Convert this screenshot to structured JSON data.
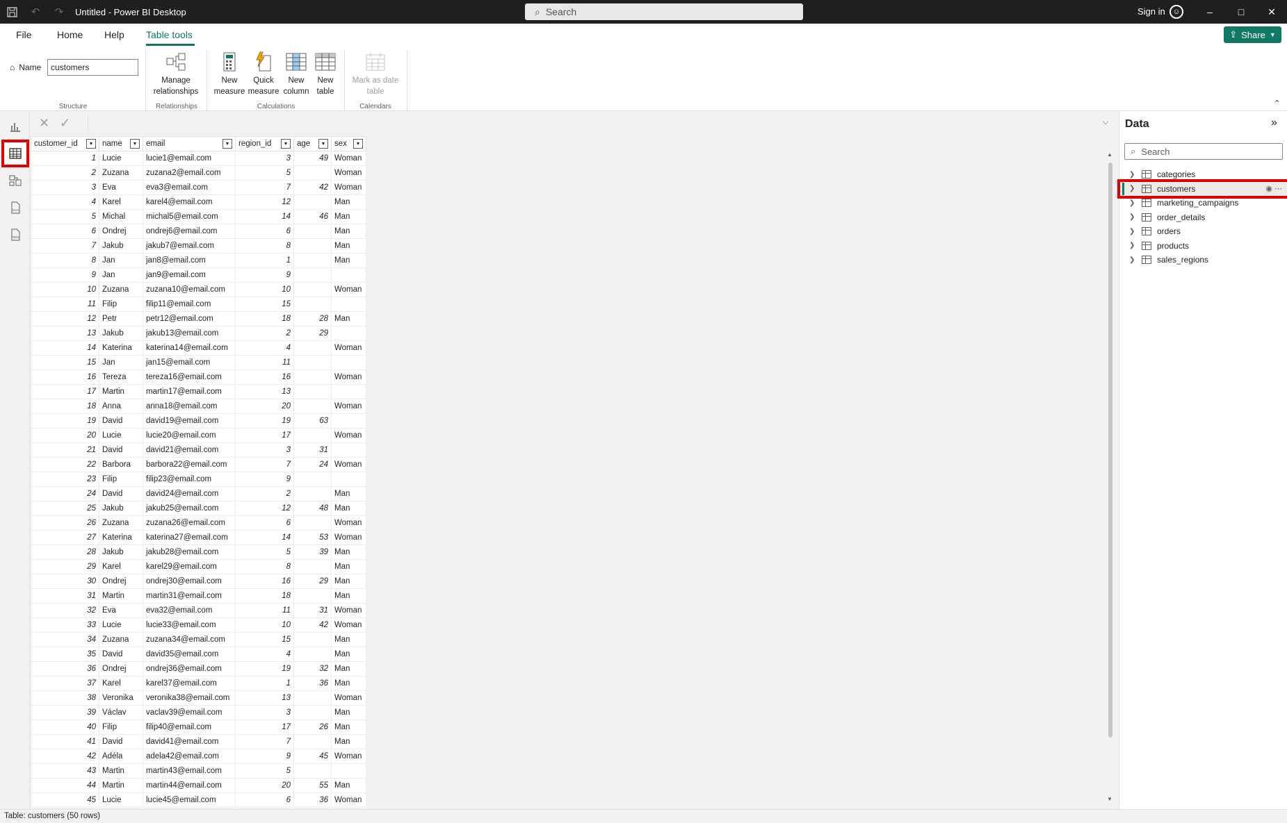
{
  "window": {
    "title": "Untitled - Power BI Desktop",
    "search_placeholder": "Search",
    "sign_in": "Sign in"
  },
  "menu": {
    "tabs": [
      "File",
      "Home",
      "Help",
      "Table tools"
    ],
    "active_tab": "Table tools",
    "share": "Share"
  },
  "ribbon": {
    "name_label": "Name",
    "name_value": "customers",
    "groups": {
      "structure": "Structure",
      "relationships": "Relationships",
      "calculations": "Calculations",
      "calendars": "Calendars"
    },
    "buttons": {
      "manage_relationships": [
        "Manage",
        "relationships"
      ],
      "new_measure": [
        "New",
        "measure"
      ],
      "quick_measure": [
        "Quick",
        "measure"
      ],
      "new_column": [
        "New",
        "column"
      ],
      "new_table": [
        "New",
        "table"
      ],
      "mark_as_date_table": [
        "Mark as date",
        "table"
      ]
    }
  },
  "left_nav": [
    "report-view",
    "table-view",
    "model-view",
    "dax-query-view",
    "tmdl-view"
  ],
  "table": {
    "columns": [
      "customer_id",
      "name",
      "email",
      "region_id",
      "age",
      "sex"
    ],
    "rows": [
      [
        "1",
        "Lucie",
        "lucie1@email.com",
        "3",
        "49",
        "Woman"
      ],
      [
        "2",
        "Zuzana",
        "zuzana2@email.com",
        "5",
        "",
        "Woman"
      ],
      [
        "3",
        "Eva",
        "eva3@email.com",
        "7",
        "42",
        "Woman"
      ],
      [
        "4",
        "Karel",
        "karel4@email.com",
        "12",
        "",
        "Man"
      ],
      [
        "5",
        "Michal",
        "michal5@email.com",
        "14",
        "46",
        "Man"
      ],
      [
        "6",
        "Ondrej",
        "ondrej6@email.com",
        "6",
        "",
        "Man"
      ],
      [
        "7",
        "Jakub",
        "jakub7@email.com",
        "8",
        "",
        "Man"
      ],
      [
        "8",
        "Jan",
        "jan8@email.com",
        "1",
        "",
        "Man"
      ],
      [
        "9",
        "Jan",
        "jan9@email.com",
        "9",
        "",
        ""
      ],
      [
        "10",
        "Zuzana",
        "zuzana10@email.com",
        "10",
        "",
        "Woman"
      ],
      [
        "11",
        "Filip",
        "filip11@email.com",
        "15",
        "",
        ""
      ],
      [
        "12",
        "Petr",
        "petr12@email.com",
        "18",
        "28",
        "Man"
      ],
      [
        "13",
        "Jakub",
        "jakub13@email.com",
        "2",
        "29",
        ""
      ],
      [
        "14",
        "Katerina",
        "katerina14@email.com",
        "4",
        "",
        "Woman"
      ],
      [
        "15",
        "Jan",
        "jan15@email.com",
        "11",
        "",
        ""
      ],
      [
        "16",
        "Tereza",
        "tereza16@email.com",
        "16",
        "",
        "Woman"
      ],
      [
        "17",
        "Martin",
        "martin17@email.com",
        "13",
        "",
        ""
      ],
      [
        "18",
        "Anna",
        "anna18@email.com",
        "20",
        "",
        "Woman"
      ],
      [
        "19",
        "David",
        "david19@email.com",
        "19",
        "63",
        ""
      ],
      [
        "20",
        "Lucie",
        "lucie20@email.com",
        "17",
        "",
        "Woman"
      ],
      [
        "21",
        "David",
        "david21@email.com",
        "3",
        "31",
        ""
      ],
      [
        "22",
        "Barbora",
        "barbora22@email.com",
        "7",
        "24",
        "Woman"
      ],
      [
        "23",
        "Filip",
        "filip23@email.com",
        "9",
        "",
        ""
      ],
      [
        "24",
        "David",
        "david24@email.com",
        "2",
        "",
        "Man"
      ],
      [
        "25",
        "Jakub",
        "jakub25@email.com",
        "12",
        "48",
        "Man"
      ],
      [
        "26",
        "Zuzana",
        "zuzana26@email.com",
        "6",
        "",
        "Woman"
      ],
      [
        "27",
        "Katerina",
        "katerina27@email.com",
        "14",
        "53",
        "Woman"
      ],
      [
        "28",
        "Jakub",
        "jakub28@email.com",
        "5",
        "39",
        "Man"
      ],
      [
        "29",
        "Karel",
        "karel29@email.com",
        "8",
        "",
        "Man"
      ],
      [
        "30",
        "Ondrej",
        "ondrej30@email.com",
        "16",
        "29",
        "Man"
      ],
      [
        "31",
        "Martin",
        "martin31@email.com",
        "18",
        "",
        "Man"
      ],
      [
        "32",
        "Eva",
        "eva32@email.com",
        "11",
        "31",
        "Woman"
      ],
      [
        "33",
        "Lucie",
        "lucie33@email.com",
        "10",
        "42",
        "Woman"
      ],
      [
        "34",
        "Zuzana",
        "zuzana34@email.com",
        "15",
        "",
        "Man"
      ],
      [
        "35",
        "David",
        "david35@email.com",
        "4",
        "",
        "Man"
      ],
      [
        "36",
        "Ondrej",
        "ondrej36@email.com",
        "19",
        "32",
        "Man"
      ],
      [
        "37",
        "Karel",
        "karel37@email.com",
        "1",
        "36",
        "Man"
      ],
      [
        "38",
        "Veronika",
        "veronika38@email.com",
        "13",
        "",
        "Woman"
      ],
      [
        "39",
        "Václav",
        "vaclav39@email.com",
        "3",
        "",
        "Man"
      ],
      [
        "40",
        "Filip",
        "filip40@email.com",
        "17",
        "26",
        "Man"
      ],
      [
        "41",
        "David",
        "david41@email.com",
        "7",
        "",
        "Man"
      ],
      [
        "42",
        "Adéla",
        "adela42@email.com",
        "9",
        "45",
        "Woman"
      ],
      [
        "43",
        "Martin",
        "martin43@email.com",
        "5",
        "",
        ""
      ],
      [
        "44",
        "Martin",
        "martin44@email.com",
        "20",
        "55",
        "Man"
      ],
      [
        "45",
        "Lucie",
        "lucie45@email.com",
        "6",
        "36",
        "Woman"
      ]
    ]
  },
  "data_pane": {
    "title": "Data",
    "search_placeholder": "Search",
    "tables": [
      "categories",
      "customers",
      "marketing_campaigns",
      "order_details",
      "orders",
      "products",
      "sales_regions"
    ],
    "selected": "customers"
  },
  "status": "Table: customers (50 rows)",
  "colors": {
    "accent": "#117865",
    "highlight": "#e00000",
    "titlebar": "#1f1f1f"
  }
}
